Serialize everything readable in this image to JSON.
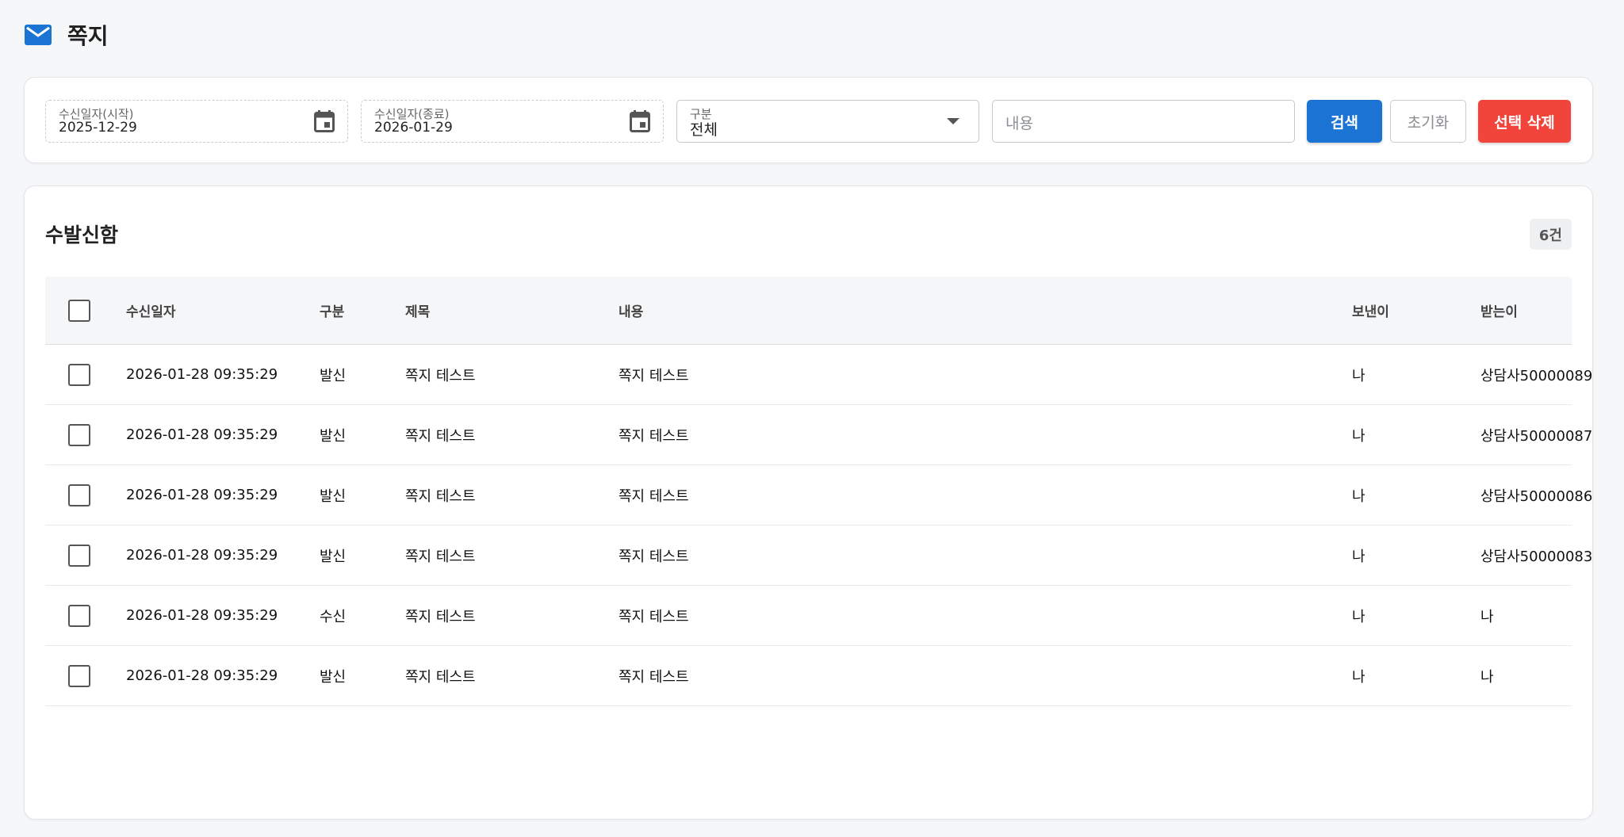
{
  "header": {
    "title": "쪽지",
    "icon": "mail-icon",
    "accent": "#1b74d4"
  },
  "filters": {
    "start_date": {
      "label": "수신일자(시작)",
      "value": "2025-12-29"
    },
    "end_date": {
      "label": "수신일자(종료)",
      "value": "2026-01-29"
    },
    "type": {
      "label": "구분",
      "value": "전체"
    },
    "content": {
      "placeholder": "내용"
    },
    "search_label": "검색",
    "reset_label": "초기화",
    "delete_label": "선택 삭제"
  },
  "list": {
    "title": "수발신함",
    "count": "6건",
    "columns": [
      "수신일자",
      "구분",
      "제목",
      "내용",
      "보낸이",
      "받는이"
    ],
    "rows": [
      {
        "date": "2026-01-28 09:35:29",
        "type": "발신",
        "subject": "쪽지 테스트",
        "body": "쪽지 테스트",
        "from": "나",
        "to": "상담사50000089"
      },
      {
        "date": "2026-01-28 09:35:29",
        "type": "발신",
        "subject": "쪽지 테스트",
        "body": "쪽지 테스트",
        "from": "나",
        "to": "상담사50000087"
      },
      {
        "date": "2026-01-28 09:35:29",
        "type": "발신",
        "subject": "쪽지 테스트",
        "body": "쪽지 테스트",
        "from": "나",
        "to": "상담사50000086"
      },
      {
        "date": "2026-01-28 09:35:29",
        "type": "발신",
        "subject": "쪽지 테스트",
        "body": "쪽지 테스트",
        "from": "나",
        "to": "상담사50000083"
      },
      {
        "date": "2026-01-28 09:35:29",
        "type": "수신",
        "subject": "쪽지 테스트",
        "body": "쪽지 테스트",
        "from": "나",
        "to": "나"
      },
      {
        "date": "2026-01-28 09:35:29",
        "type": "발신",
        "subject": "쪽지 테스트",
        "body": "쪽지 테스트",
        "from": "나",
        "to": "나"
      }
    ]
  }
}
